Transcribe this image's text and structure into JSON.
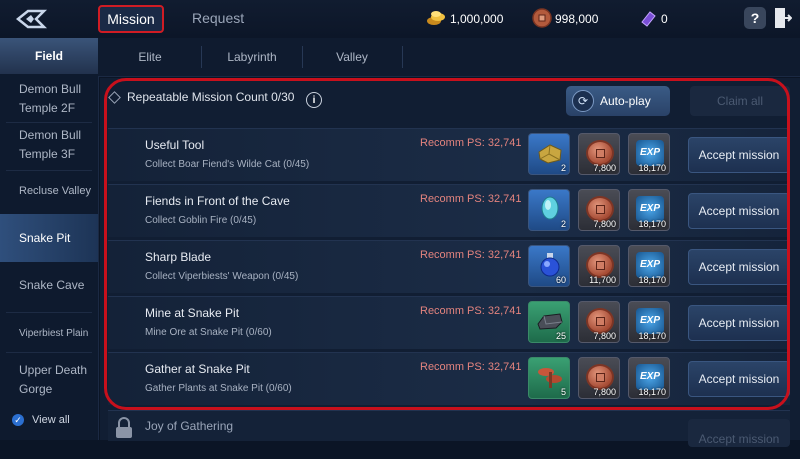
{
  "header": {
    "tabs": [
      {
        "label": "Mission",
        "active": true
      },
      {
        "label": "Request",
        "active": false
      }
    ],
    "currencies": [
      {
        "icon": "gold-coins-icon",
        "value": "1,000,000"
      },
      {
        "icon": "copper-coin-icon",
        "value": "998,000"
      },
      {
        "icon": "purple-ticket-icon",
        "value": "0"
      }
    ],
    "help_label": "?"
  },
  "sidebar": {
    "header": "Field",
    "items": [
      {
        "label": "Demon Bull Temple 2F"
      },
      {
        "label": "Demon Bull Temple 3F"
      },
      {
        "label": "Recluse Valley"
      },
      {
        "label": "Snake Pit",
        "active": true
      },
      {
        "label": "Snake Cave"
      },
      {
        "label": "Viperbiest Plain"
      },
      {
        "label": "Upper Death Gorge"
      }
    ],
    "view_all": "View all"
  },
  "subtabs": [
    "Elite",
    "Labyrinth",
    "Valley"
  ],
  "mission_panel": {
    "count_label": "Repeatable Mission Count 0/30",
    "autoplay_label": "Auto-play",
    "claim_all_label": "Claim all"
  },
  "missions": [
    {
      "title": "Useful Tool",
      "desc": "Collect Boar Fiend's Wilde Cat (0/45)",
      "ps": "Recomm PS: 32,741",
      "item_icon": "gold-ore-icon",
      "item_count": "2",
      "coin": "7,800",
      "exp": "18,170",
      "button": "Accept mission"
    },
    {
      "title": "Fiends in Front of the Cave",
      "desc": "Collect Goblin Fire (0/45)",
      "ps": "Recomm PS: 32,741",
      "item_icon": "blue-crystal-icon",
      "item_count": "2",
      "coin": "7,800",
      "exp": "18,170",
      "button": "Accept mission"
    },
    {
      "title": "Sharp Blade",
      "desc": "Collect Viperbiests' Weapon (0/45)",
      "ps": "Recomm PS: 32,741",
      "item_icon": "blue-potion-icon",
      "item_count": "60",
      "coin": "11,700",
      "exp": "18,170",
      "button": "Accept mission"
    },
    {
      "title": "Mine at Snake Pit",
      "desc": "Mine Ore at Snake Pit (0/60)",
      "ps": "Recomm PS: 32,741",
      "item_icon": "iron-ore-icon",
      "item_count": "25",
      "coin": "7,800",
      "exp": "18,170",
      "button": "Accept mission"
    },
    {
      "title": "Gather at Snake Pit",
      "desc": "Gather Plants at Snake Pit (0/60)",
      "ps": "Recomm PS: 32,741",
      "item_icon": "mushroom-plant-icon",
      "item_count": "5",
      "coin": "7,800",
      "exp": "18,170",
      "button": "Accept mission"
    }
  ],
  "locked_mission": {
    "title": "Joy of Gathering",
    "button": "Accept mission"
  },
  "exp_label": "EXP",
  "colors": {
    "accent": "#c8101c",
    "panel": "#111e33",
    "ps_text": "#e3837e"
  }
}
